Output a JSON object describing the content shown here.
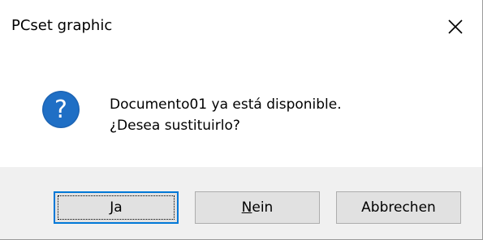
{
  "window": {
    "title": "PCset graphic"
  },
  "message": {
    "line1": "Documento01 ya está disponible.",
    "line2": "¿Desea sustituirlo?",
    "icon": "question-icon"
  },
  "buttons": {
    "yes": {
      "mnemonic": "J",
      "rest": "a"
    },
    "no": {
      "mnemonic": "N",
      "rest": "ein"
    },
    "cancel": {
      "label": "Abbrechen"
    }
  },
  "colors": {
    "icon_blue": "#1c64b4",
    "focus_border": "#0078d7",
    "footer_bg": "#f0f0f0",
    "button_bg": "#e1e1e1"
  }
}
